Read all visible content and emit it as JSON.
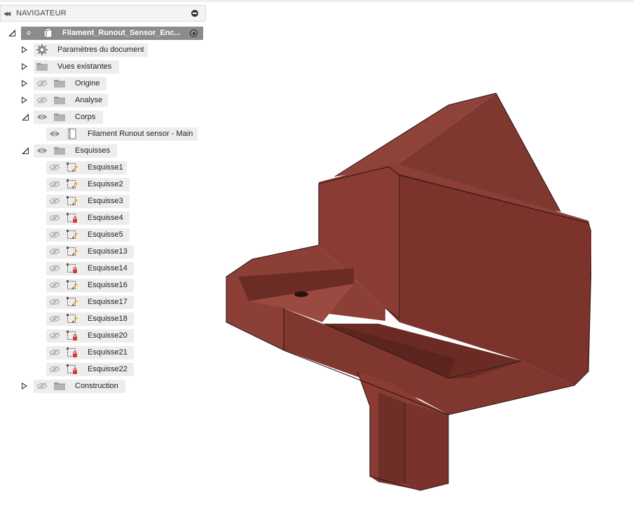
{
  "navigator": {
    "title": "NAVIGATEUR",
    "root": {
      "label": "Filament_Runout_Sensor_Enc..."
    },
    "items": [
      {
        "label": "Paramètres du document",
        "icon": "gear-icon"
      },
      {
        "label": "Vues existantes",
        "icon": "folder-icon"
      },
      {
        "label": "Origine",
        "icon": "folder-icon",
        "visible": false
      },
      {
        "label": "Analyse",
        "icon": "folder-icon",
        "visible": false
      },
      {
        "label": "Corps",
        "icon": "folder-icon",
        "visible": true
      },
      {
        "label": "Filament Runout sensor - Main",
        "icon": "body-icon",
        "visible": true
      },
      {
        "label": "Esquisses",
        "icon": "folder-icon",
        "visible": true
      },
      {
        "label": "Construction",
        "icon": "folder-icon",
        "visible": false
      }
    ],
    "sketches": [
      {
        "label": "Esquisse1",
        "locked": false
      },
      {
        "label": "Esquisse2",
        "locked": false
      },
      {
        "label": "Esquisse3",
        "locked": false
      },
      {
        "label": "Esquisse4",
        "locked": true
      },
      {
        "label": "Esquisse5",
        "locked": false
      },
      {
        "label": "Esquisse13",
        "locked": false
      },
      {
        "label": "Esquisse14",
        "locked": true
      },
      {
        "label": "Esquisse16",
        "locked": false
      },
      {
        "label": "Esquisse17",
        "locked": false
      },
      {
        "label": "Esquisse18",
        "locked": false
      },
      {
        "label": "Esquisse20",
        "locked": true
      },
      {
        "label": "Esquisse21",
        "locked": true
      },
      {
        "label": "Esquisse22",
        "locked": true
      }
    ]
  },
  "colors": {
    "model_body": "#8a3f37",
    "model_dark": "#6b2d27",
    "model_light": "#9c4a41",
    "sketch_lock": "#d23a3a",
    "sketch_pencil": "#f0a830"
  }
}
